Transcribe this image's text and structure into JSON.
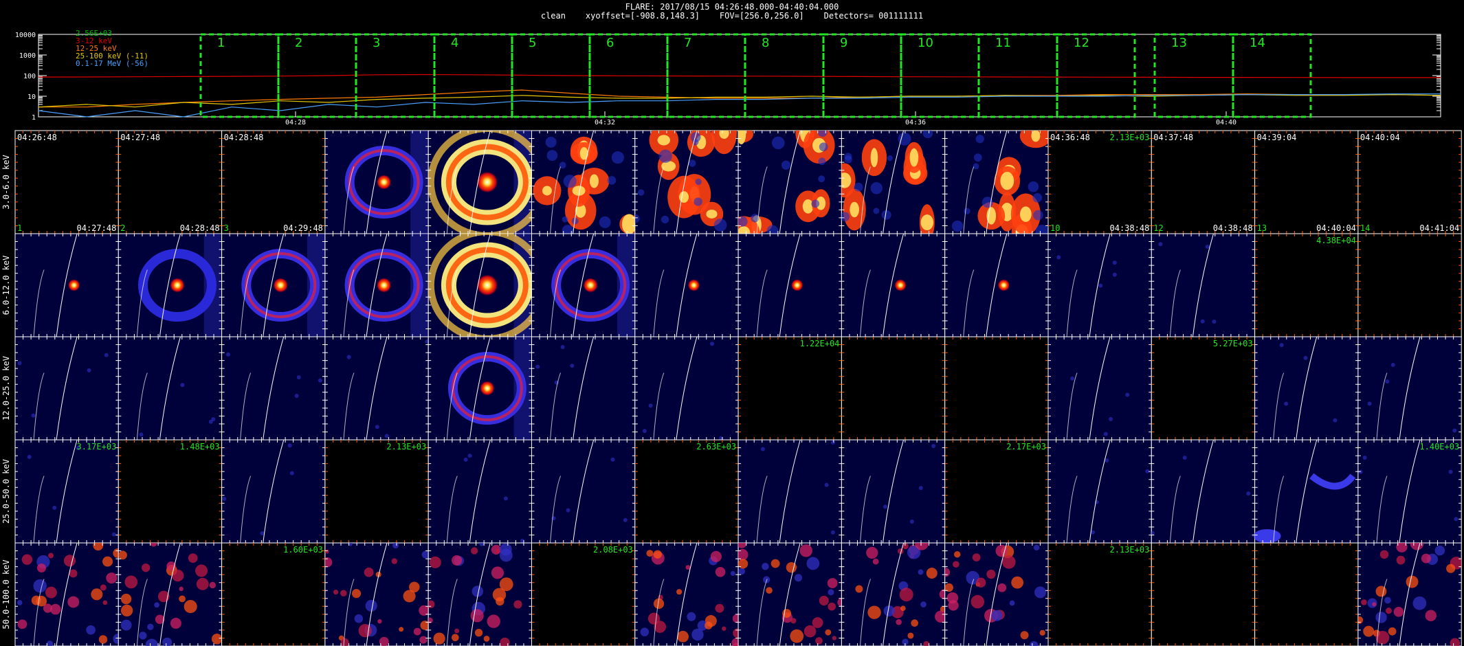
{
  "header": {
    "line1": "FLARE: 2017/08/15 04:26:48.000-04:40:04.000",
    "line2": "clean    xyoffset=[-908.8,148.3]    FOV=[256.0,256.0]    Detectors= 001111111"
  },
  "chart_data": [
    {
      "type": "line",
      "name": "lightcurve",
      "y_scale": "log",
      "ylim": [
        1,
        10000
      ],
      "y_ticks": [
        "10000",
        "1000",
        "100",
        "10",
        "1"
      ],
      "x_ticks": [
        "04:28",
        "04:32",
        "04:36",
        "04:40"
      ],
      "series": [
        {
          "name": "2.56E+03",
          "color": "#00c000",
          "values": []
        },
        {
          "name": "3-12 keV",
          "color": "#e00000",
          "values": [
            85,
            86,
            88,
            90,
            92,
            95,
            100,
            110,
            112,
            110,
            105,
            100,
            98,
            96,
            95,
            94,
            92,
            90,
            88,
            87,
            86,
            85,
            84,
            83,
            82,
            82,
            81,
            80,
            80,
            80
          ]
        },
        {
          "name": "12-25 keV",
          "color": "#ff7a00",
          "values": [
            3,
            3,
            4,
            5,
            6,
            7,
            8,
            9,
            12,
            16,
            20,
            14,
            10,
            9,
            8,
            8,
            8,
            9,
            10,
            10,
            11,
            11,
            12,
            12,
            12,
            13,
            12,
            12,
            12,
            11
          ]
        },
        {
          "name": "25-100 keV (-11)",
          "color": "#e6c800",
          "values": [
            3,
            4,
            3,
            5,
            4,
            6,
            5,
            7,
            8,
            9,
            11,
            9,
            8,
            8,
            9,
            9,
            10,
            9,
            10,
            10,
            11,
            10,
            11,
            10,
            11,
            12,
            11,
            11,
            12,
            11
          ]
        },
        {
          "name": "0.1-17 MeV (-56)",
          "color": "#4aa0ff",
          "values": [
            2,
            1,
            2,
            1,
            3,
            2,
            4,
            3,
            5,
            4,
            6,
            5,
            6,
            6,
            7,
            7,
            8,
            8,
            9,
            9,
            10,
            10,
            10,
            11,
            11,
            12,
            12,
            12,
            13,
            13
          ]
        }
      ],
      "intervals": [
        "1",
        "2",
        "3",
        "4",
        "5",
        "6",
        "7",
        "8",
        "9",
        "10",
        "11",
        "12",
        "13",
        "14"
      ]
    },
    {
      "type": "heatmap",
      "name": "image-grid",
      "rows": [
        "3.0-6.0 keV",
        "6.0-12.0 keV",
        "12.0-25.0 keV",
        "25.0-50.0 keV",
        "50.0-100.0 keV"
      ],
      "tile_top_left": [
        [
          "04:26:48",
          "04:27:48",
          "04:28:48",
          "",
          "",
          "",
          "",
          "",
          "",
          "",
          "04:36:48",
          "04:37:48",
          "04:39:04",
          "04:40:04"
        ],
        [
          "",
          "",
          "",
          "",
          "",
          "",
          "",
          "",
          "",
          "",
          "",
          "",
          "",
          "",
          ""
        ],
        [
          "",
          "",
          "",
          "",
          "",
          "",
          "",
          "",
          "",
          "",
          "",
          "",
          "",
          ""
        ],
        [
          "",
          "",
          "",
          "",
          "",
          "",
          "",
          "",
          "",
          "",
          "",
          "",
          "",
          ""
        ],
        [
          "",
          "",
          "",
          "",
          "",
          "",
          "",
          "",
          "",
          "",
          "",
          "",
          "",
          ""
        ]
      ],
      "tile_top_right": [
        [
          "",
          "",
          "",
          "",
          "",
          "",
          "",
          "",
          "",
          "",
          "2.13E+03",
          "",
          "",
          ""
        ],
        [
          "",
          "",
          "",
          "",
          "",
          "",
          "",
          "",
          "",
          "",
          "",
          "",
          "4.38E+04",
          ""
        ],
        [
          "",
          "",
          "",
          "",
          "",
          "",
          "",
          "1.22E+04",
          "",
          "",
          "",
          "5.27E+03",
          "",
          ""
        ],
        [
          "3.17E+03",
          "1.48E+03",
          "",
          "2.13E+03",
          "",
          "",
          "2.63E+03",
          "",
          "",
          "2.17E+03",
          "",
          "",
          "",
          "1.40E+03"
        ],
        [
          "",
          "",
          "1.60E+03",
          "",
          "",
          "2.08E+03",
          "",
          "",
          "",
          "",
          "2.13E+03",
          "",
          "",
          ""
        ]
      ],
      "tile_bottom_left": [
        "1",
        "2",
        "3",
        "",
        "",
        "",
        "",
        "",
        "",
        "",
        "10",
        "12",
        "13",
        "14"
      ],
      "tile_bottom_right": [
        "04:27:48",
        "04:28:48",
        "04:29:48",
        "",
        "",
        "",
        "",
        "",
        "",
        "",
        "04:38:48",
        "04:38:48",
        "04:40:04",
        "04:41:04"
      ],
      "intensity": [
        [
          "empty",
          "empty",
          "empty",
          "ring-med",
          "ring-strong",
          "blobs",
          "blobs",
          "blobs",
          "blobs",
          "blobs",
          "empty",
          "empty",
          "empty",
          "empty"
        ],
        [
          "dot-small",
          "ring-faint",
          "ring-med",
          "ring-med",
          "ring-strong",
          "ring-med",
          "dot-small",
          "dot-small",
          "dot-small",
          "dot-small",
          "faint",
          "faint",
          "empty",
          "empty"
        ],
        [
          "faint",
          "faint",
          "faint",
          "faint",
          "ring-med",
          "faint",
          "faint",
          "empty",
          "empty",
          "empty",
          "faint",
          "empty",
          "faint",
          "faint"
        ],
        [
          "faint",
          "empty",
          "faint",
          "empty",
          "faint",
          "faint",
          "empty",
          "faint",
          "faint",
          "empty",
          "faint",
          "faint",
          "arc",
          "faint"
        ],
        [
          "noise",
          "noise",
          "empty",
          "noise",
          "noise",
          "empty",
          "noise",
          "noise",
          "noise",
          "noise",
          "empty",
          "empty",
          "empty",
          "noise"
        ]
      ]
    }
  ]
}
